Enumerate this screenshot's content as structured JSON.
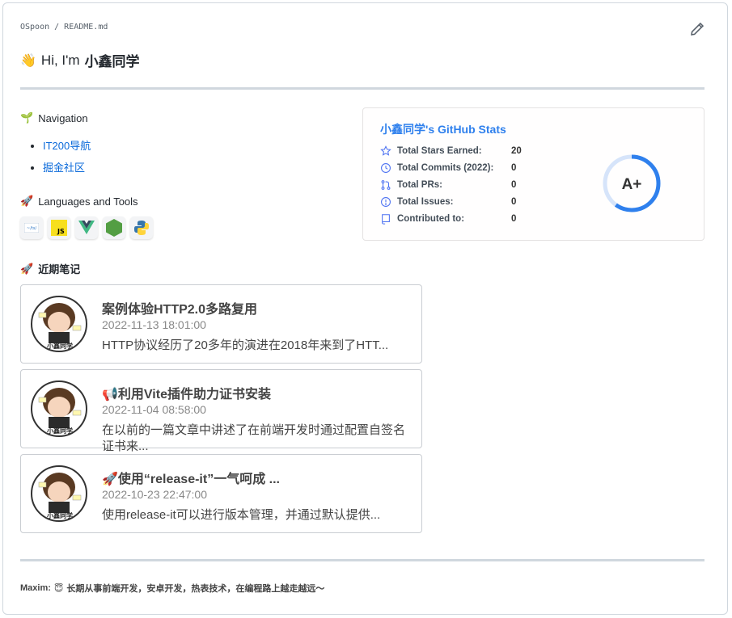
{
  "breadcrumb": "OSpoon / README.md",
  "heading": {
    "emoji": "👋",
    "prefix": "Hi, I'm",
    "name": "小鑫同学"
  },
  "navigation": {
    "emoji": "🌱",
    "title": "Navigation",
    "links": [
      {
        "label": "IT200导航"
      },
      {
        "label": "掘金社区"
      }
    ]
  },
  "tools_section": {
    "emoji": "🚀",
    "title": "Languages and Tools",
    "tools": [
      {
        "name": "ts-icon"
      },
      {
        "name": "javascript-icon"
      },
      {
        "name": "vue-icon"
      },
      {
        "name": "nodejs-icon"
      },
      {
        "name": "python-icon"
      }
    ]
  },
  "notes_section": {
    "emoji": "🚀",
    "title": "近期笔记",
    "posts": [
      {
        "title": "案例体验HTTP2.0多路复用",
        "date": "2022-11-13 18:01:00",
        "desc": "HTTP协议经历了20多年的演进在2018年来到了HTT..."
      },
      {
        "title": "📢利用Vite插件助力证书安装",
        "date": "2022-11-04 08:58:00",
        "desc": "在以前的一篇文章中讲述了在前端开发时通过配置自签名证书来..."
      },
      {
        "title": "🚀使用“release-it”一气呵成 ...",
        "date": "2022-10-23 22:47:00",
        "desc": "使用release-it可以进行版本管理，并通过默认提供..."
      }
    ]
  },
  "stats": {
    "title": "小鑫同学's GitHub Stats",
    "rows": [
      {
        "label": "Total Stars Earned:",
        "value": "20",
        "icon": "star-icon"
      },
      {
        "label": "Total Commits (2022):",
        "value": "0",
        "icon": "clock-icon"
      },
      {
        "label": "Total PRs:",
        "value": "0",
        "icon": "pull-request-icon"
      },
      {
        "label": "Total Issues:",
        "value": "0",
        "icon": "issue-icon"
      },
      {
        "label": "Contributed to:",
        "value": "0",
        "icon": "repo-icon"
      }
    ],
    "grade": "A+",
    "grade_progress": 0.6,
    "accent": "#2f80ed"
  },
  "footer": {
    "label": "Maxim:",
    "emoji": "😇",
    "text": "长期从事前端开发，安卓开发，热表技术，在编程路上越走越远～"
  }
}
